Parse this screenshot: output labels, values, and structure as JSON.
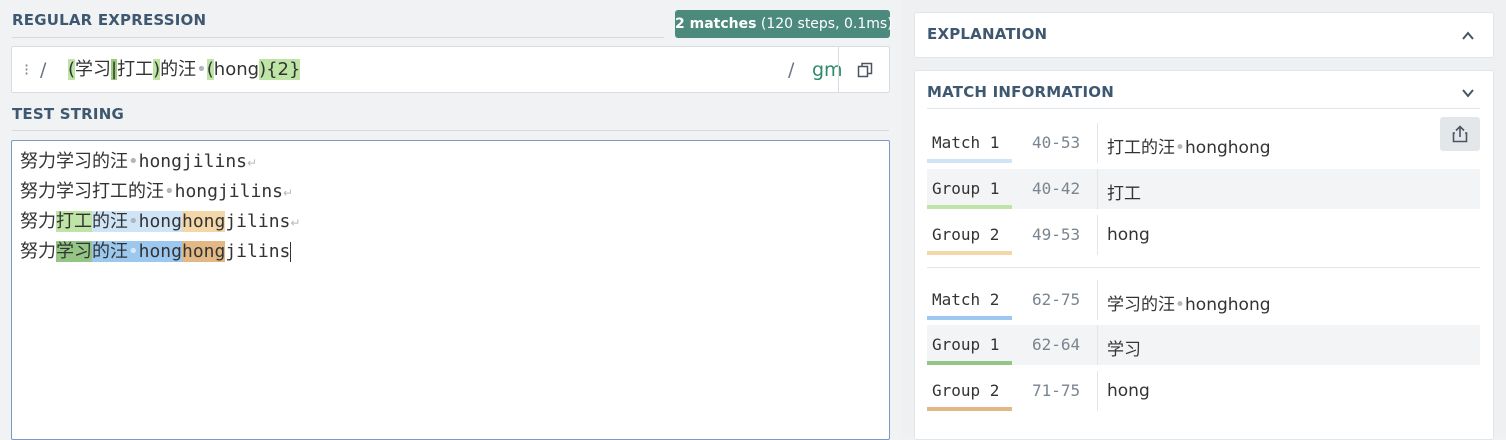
{
  "regex": {
    "title": "REGULAR EXPRESSION",
    "matches_badge_bold": "2 matches",
    "matches_badge_sub": " (120 steps, 0.1ms)",
    "open_delim": "/",
    "close_delim": "/",
    "flags": "gm",
    "pattern_parts": {
      "open1": "(",
      "alt1": "学习",
      "pipe": "|",
      "alt2": "打工",
      "close1": ")",
      "lit": "的汪",
      "space": "•",
      "open2": "(",
      "grp2": "hong",
      "close2": ")",
      "quant": "{2}"
    }
  },
  "test_string": {
    "title": "TEST STRING",
    "lines": [
      {
        "a": "努力学习的汪",
        "b": "hongjilins"
      },
      {
        "a": "努力学习打工的汪",
        "b": "hongjilins"
      },
      {
        "pre": "努力",
        "g1": "打工",
        "mid": "的汪",
        "sp": "•",
        "m": "hong",
        "g2": "hong",
        "post": "jilins"
      },
      {
        "pre": "努力",
        "g1": "学习",
        "mid": "的汪",
        "sp": "•",
        "m": "hong",
        "g2": "hong",
        "post": "jilins"
      }
    ],
    "space_glyph": "•",
    "newline_glyph": "↵"
  },
  "explanation": {
    "title": "EXPLANATION"
  },
  "match_info": {
    "title": "MATCH INFORMATION",
    "rows": [
      {
        "label": "Match 1",
        "range": "40-53",
        "value_a": "打工的汪",
        "value_sep": "•",
        "value_b": "honghong"
      },
      {
        "label": "Group 1",
        "range": "40-42",
        "value": "打工"
      },
      {
        "label": "Group 2",
        "range": "49-53",
        "value": "hong"
      },
      {
        "label": "Match 2",
        "range": "62-75",
        "value_a": "学习的汪",
        "value_sep": "•",
        "value_b": "honghong"
      },
      {
        "label": "Group 1",
        "range": "62-64",
        "value": "学习"
      },
      {
        "label": "Group 2",
        "range": "71-75",
        "value": "hong"
      }
    ]
  },
  "colors": {
    "badge": "#4d8a7e",
    "match1": "#cfe4f7",
    "group1_m1": "#bfe5a6",
    "group2_m1": "#f3d7a8",
    "match2": "#9cc8f0",
    "group1_m2": "#93c585",
    "group2_m2": "#e2b985"
  },
  "icons": [
    "drag-handle-icon",
    "copy-icon",
    "chevron-up-icon",
    "chevron-down-icon",
    "share-icon"
  ]
}
